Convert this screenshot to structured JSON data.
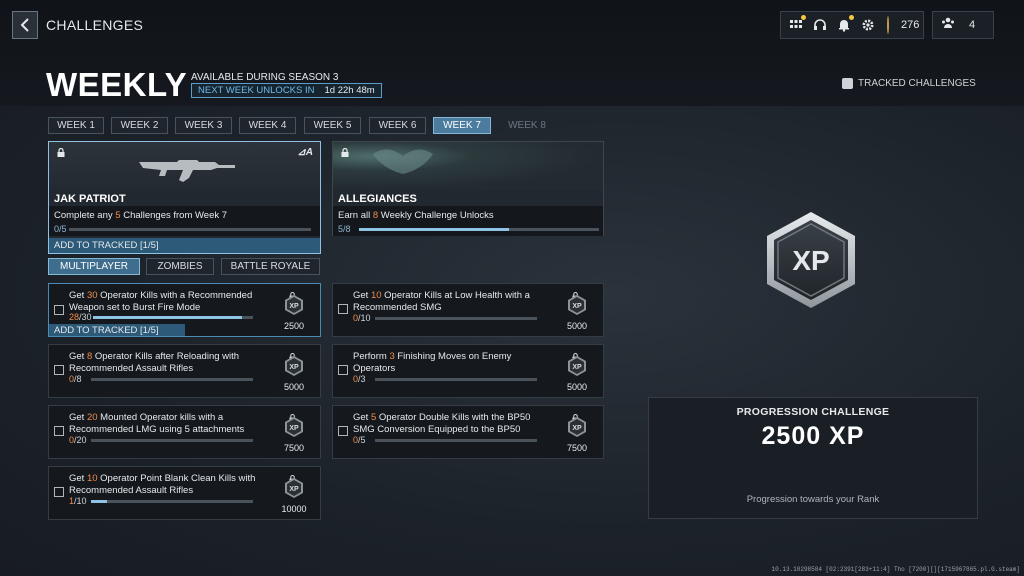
{
  "header": {
    "breadcrumb": "CHALLENGES",
    "title": "WEEKLY",
    "availability": "AVAILABLE DURING SEASON 3",
    "next_unlock_label": "NEXT WEEK UNLOCKS IN",
    "next_unlock_value": "1d 22h 48m",
    "tracked_challenges": "TRACKED CHALLENGES",
    "currency": "276",
    "party_count": "4"
  },
  "weeks": [
    {
      "label": "WEEK 1"
    },
    {
      "label": "WEEK 2"
    },
    {
      "label": "WEEK 3"
    },
    {
      "label": "WEEK 4"
    },
    {
      "label": "WEEK 5"
    },
    {
      "label": "WEEK 6"
    },
    {
      "label": "WEEK 7",
      "active": true
    },
    {
      "label": "WEEK 8",
      "locked": true
    }
  ],
  "features": [
    {
      "name": "JAK PATRIOT",
      "desc_pre": "Complete any ",
      "desc_num": "5",
      "desc_post": " Challenges from Week 7",
      "progress": "0/5",
      "progress_fraction": 0,
      "add_tracked": "ADD TO TRACKED [1/5]"
    },
    {
      "name": "ALLEGIANCES",
      "desc_pre": "Earn all ",
      "desc_num": "8",
      "desc_post": " Weekly Challenge Unlocks",
      "progress": "5/8",
      "progress_fraction": 0.625
    }
  ],
  "modes": [
    {
      "label": "MULTIPLAYER",
      "active": true
    },
    {
      "label": "ZOMBIES"
    },
    {
      "label": "BATTLE ROYALE"
    }
  ],
  "challenges": [
    {
      "pre": "Get ",
      "num": "30",
      "post": " Operator Kills with a Recommended Weapon set to Burst Fire Mode",
      "cur": "28",
      "total": "/30",
      "fraction": 0.93,
      "xp": "2500",
      "add_tracked": "ADD TO TRACKED [1/5]"
    },
    {
      "pre": "Get ",
      "num": "10",
      "post": " Operator Kills at Low Health with a Recommended SMG",
      "cur": "0",
      "total": "/10",
      "fraction": 0,
      "xp": "5000"
    },
    {
      "pre": "Get ",
      "num": "8",
      "post": " Operator Kills after Reloading with Recommended Assault Rifles",
      "cur": "0",
      "total": "/8",
      "fraction": 0,
      "xp": "5000"
    },
    {
      "pre": "Perform ",
      "num": "3",
      "post": " Finishing Moves on Enemy Operators",
      "cur": "0",
      "total": "/3",
      "fraction": 0,
      "xp": "5000"
    },
    {
      "pre": "Get ",
      "num": "20",
      "post": " Mounted Operator kills with a Recommended LMG using 5 attachments",
      "cur": "0",
      "total": "/20",
      "fraction": 0,
      "xp": "7500"
    },
    {
      "pre": "Get ",
      "num": "5",
      "post": " Operator Double Kills with the BP50 SMG Conversion Equipped to the BP50",
      "cur": "0",
      "total": "/5",
      "fraction": 0,
      "xp": "7500"
    },
    {
      "pre": "Get ",
      "num": "10",
      "post": " Operator Point Blank Clean Kills with Recommended Assault Rifles",
      "cur": "1",
      "total": "/10",
      "fraction": 0.1,
      "xp": "10000"
    }
  ],
  "progression": {
    "title": "PROGRESSION CHALLENGE",
    "value": "2500 XP",
    "desc": "Progression towards your Rank",
    "badge_text": "XP"
  },
  "footer_id": "10.13.10298584 [02:2391[283+11:4] Tho [7200][][1715967865.pl.G.steam]",
  "colors": {
    "accent": "#8fc3e6",
    "highlight": "#f08a4b",
    "active_tab": "#4b7c9e"
  }
}
